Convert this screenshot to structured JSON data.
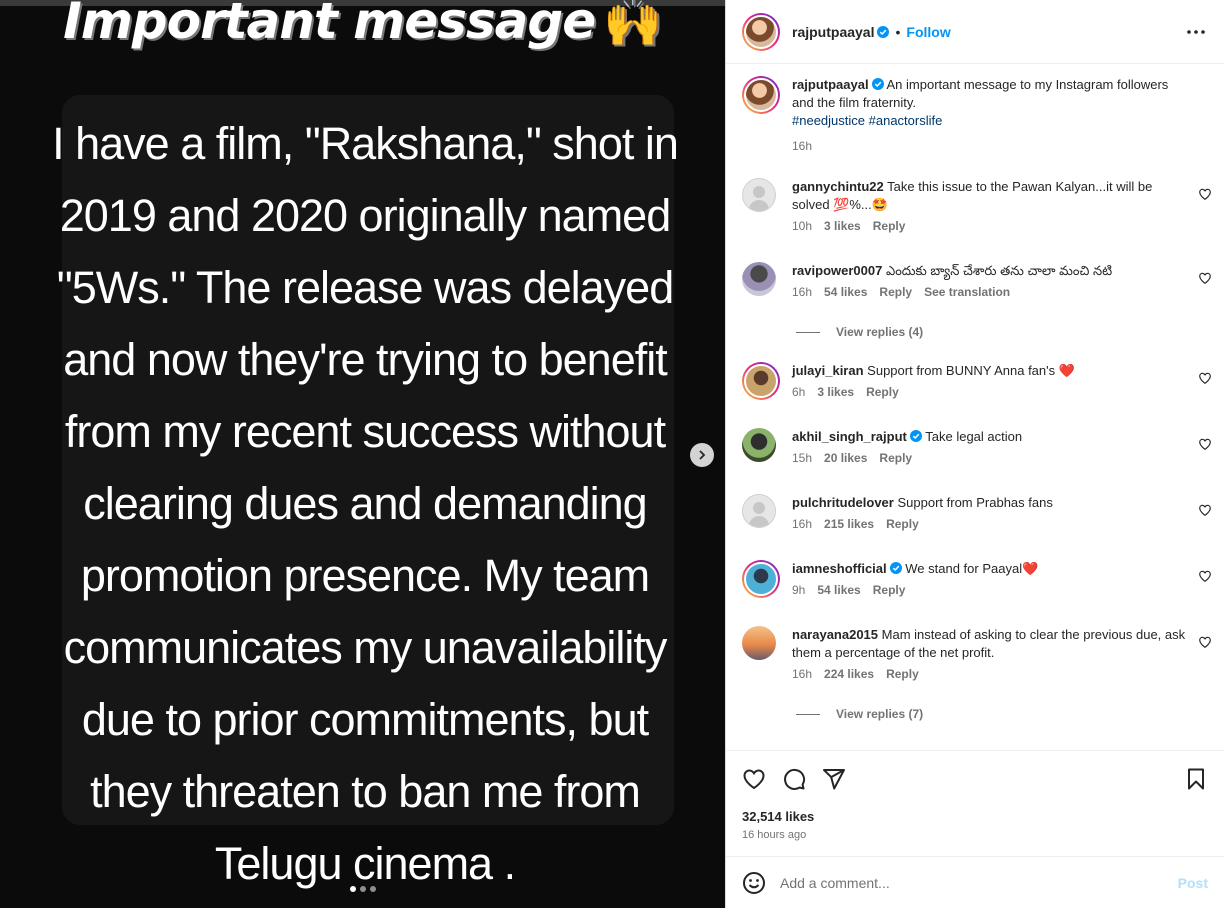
{
  "media": {
    "headline": "Important message",
    "headline_emoji": "🙌",
    "body": "I have a film, \"Rakshana,\" shot in 2019 and 2020 originally named \"5Ws.\" The release was delayed and now they're trying to benefit from my recent success without clearing dues and demanding promotion presence. My team communicates my unavailability due to prior commitments, but they threaten to ban me from Telugu cinema .",
    "slide_count": 3,
    "active_slide": 1
  },
  "header": {
    "username": "rajputpaayal",
    "separator": "•",
    "follow_label": "Follow"
  },
  "caption": {
    "username": "rajputpaayal",
    "text": "An important message to my Instagram followers and the film fraternity.",
    "hashtag_1": "#needjustice",
    "hashtag_2": "#anactorslife",
    "time": "16h"
  },
  "comments": [
    {
      "username": "gannychintu22",
      "text": "Take this issue to the Pawan Kalyan...it will be solved 💯%...🤩",
      "time": "10h",
      "likes": "3 likes",
      "reply": "Reply",
      "translation": ""
    },
    {
      "username": "ravipower0007",
      "text": "ఎందుకు బ్యాన్ చేశారు తను చాలా మంచి నటి",
      "time": "16h",
      "likes": "54 likes",
      "reply": "Reply",
      "translation": "See translation"
    },
    {
      "username": "julayi_kiran",
      "text": "Support from BUNNY Anna fan's ❤️",
      "time": "6h",
      "likes": "3 likes",
      "reply": "Reply",
      "translation": ""
    },
    {
      "username": "akhil_singh_rajput",
      "text": "Take legal action",
      "time": "15h",
      "likes": "20 likes",
      "reply": "Reply",
      "translation": ""
    },
    {
      "username": "pulchritudelover",
      "text": "Support from Prabhas fans",
      "time": "16h",
      "likes": "215 likes",
      "reply": "Reply",
      "translation": ""
    },
    {
      "username": "iamneshofficial",
      "text": "We stand for Paayal❤️",
      "time": "9h",
      "likes": "54 likes",
      "reply": "Reply",
      "translation": ""
    },
    {
      "username": "narayana2015",
      "text": "Mam instead of asking to clear the previous due, ask them a percentage of the net profit.",
      "time": "16h",
      "likes": "224 likes",
      "reply": "Reply",
      "translation": ""
    }
  ],
  "view_replies": [
    "View replies (4)",
    "View replies (7)"
  ],
  "actions": {
    "likes": "32,514 likes",
    "time_ago": "16 hours ago"
  },
  "add_comment": {
    "placeholder": "Add a comment...",
    "post_label": "Post"
  },
  "colors": {
    "accent": "#0095f6",
    "verified": "#0095f6",
    "heart_emoji": "#e0245e",
    "muted": "#737373"
  }
}
